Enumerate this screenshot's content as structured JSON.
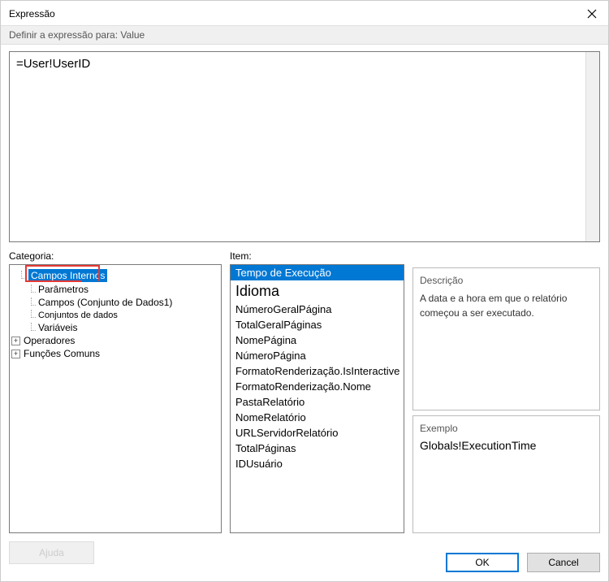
{
  "window": {
    "title": "Expressão"
  },
  "subtitle": "Definir a expressão para: Value",
  "expression": "=User!UserID",
  "labels": {
    "category": "Categoria:",
    "item": "Item:",
    "description": "Descrição",
    "example": "Exemplo"
  },
  "category_tree": {
    "selected": "Campos Internos",
    "children": {
      "parametros": "Parâmetros",
      "campos_dados": "Campos (Conjunto de Dados1)",
      "conjuntos": "Conjuntos de dados",
      "variaveis": "Variáveis"
    },
    "operadores": "Operadores",
    "funcoes": "Funções Comuns"
  },
  "items": [
    {
      "label": "Tempo de Execução",
      "selected": true
    },
    {
      "label": "Idioma",
      "big": true
    },
    {
      "label": "NúmeroGeralPágina"
    },
    {
      "label": "TotalGeralPáginas"
    },
    {
      "label": "NomePágina"
    },
    {
      "label": "NúmeroPágina"
    },
    {
      "label": "FormatoRenderização.IsInteractive"
    },
    {
      "label": "FormatoRenderização.Nome"
    },
    {
      "label": "PastaRelatório"
    },
    {
      "label": "NomeRelatório"
    },
    {
      "label": "URLServidorRelatório"
    },
    {
      "label": "TotalPáginas"
    },
    {
      "label": "IDUsuário"
    }
  ],
  "description_text": "A data e a hora em que o relatório começou a ser executado.",
  "example_text": "Globals!ExecutionTime",
  "buttons": {
    "help": "Ajuda",
    "ok": "OK",
    "cancel": "Cancel"
  }
}
